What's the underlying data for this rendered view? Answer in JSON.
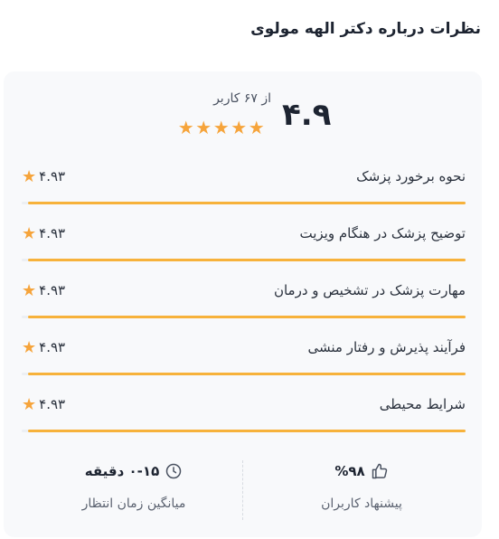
{
  "title": "نظرات درباره دکتر الهه مولوی",
  "summary": {
    "score": "۴.۹",
    "from_users": "از ۶۷ کاربر",
    "stars": 5
  },
  "criteria": [
    {
      "label": "نحوه برخورد پزشک",
      "score": "۴.۹۳",
      "fraction": 0.986
    },
    {
      "label": "توضیح پزشک در هنگام ویزیت",
      "score": "۴.۹۳",
      "fraction": 0.986
    },
    {
      "label": "مهارت پزشک در تشخیص و درمان",
      "score": "۴.۹۳",
      "fraction": 0.986
    },
    {
      "label": "فرآیند پذیرش و رفتار منشی",
      "score": "۴.۹۳",
      "fraction": 0.986
    },
    {
      "label": "شرایط محیطی",
      "score": "۴.۹۳",
      "fraction": 0.986
    }
  ],
  "stats": {
    "recommend": {
      "value": "%۹۸",
      "caption": "پیشنهاد کاربران",
      "icon": "thumbs-up-icon"
    },
    "wait": {
      "value": "۰-۱۵ دقیقه",
      "caption": "میانگین زمان انتظار",
      "icon": "clock-icon"
    }
  },
  "colors": {
    "accent": "#f7b23b",
    "star": "#f6a43b",
    "card_bg": "#f8f9fb"
  }
}
